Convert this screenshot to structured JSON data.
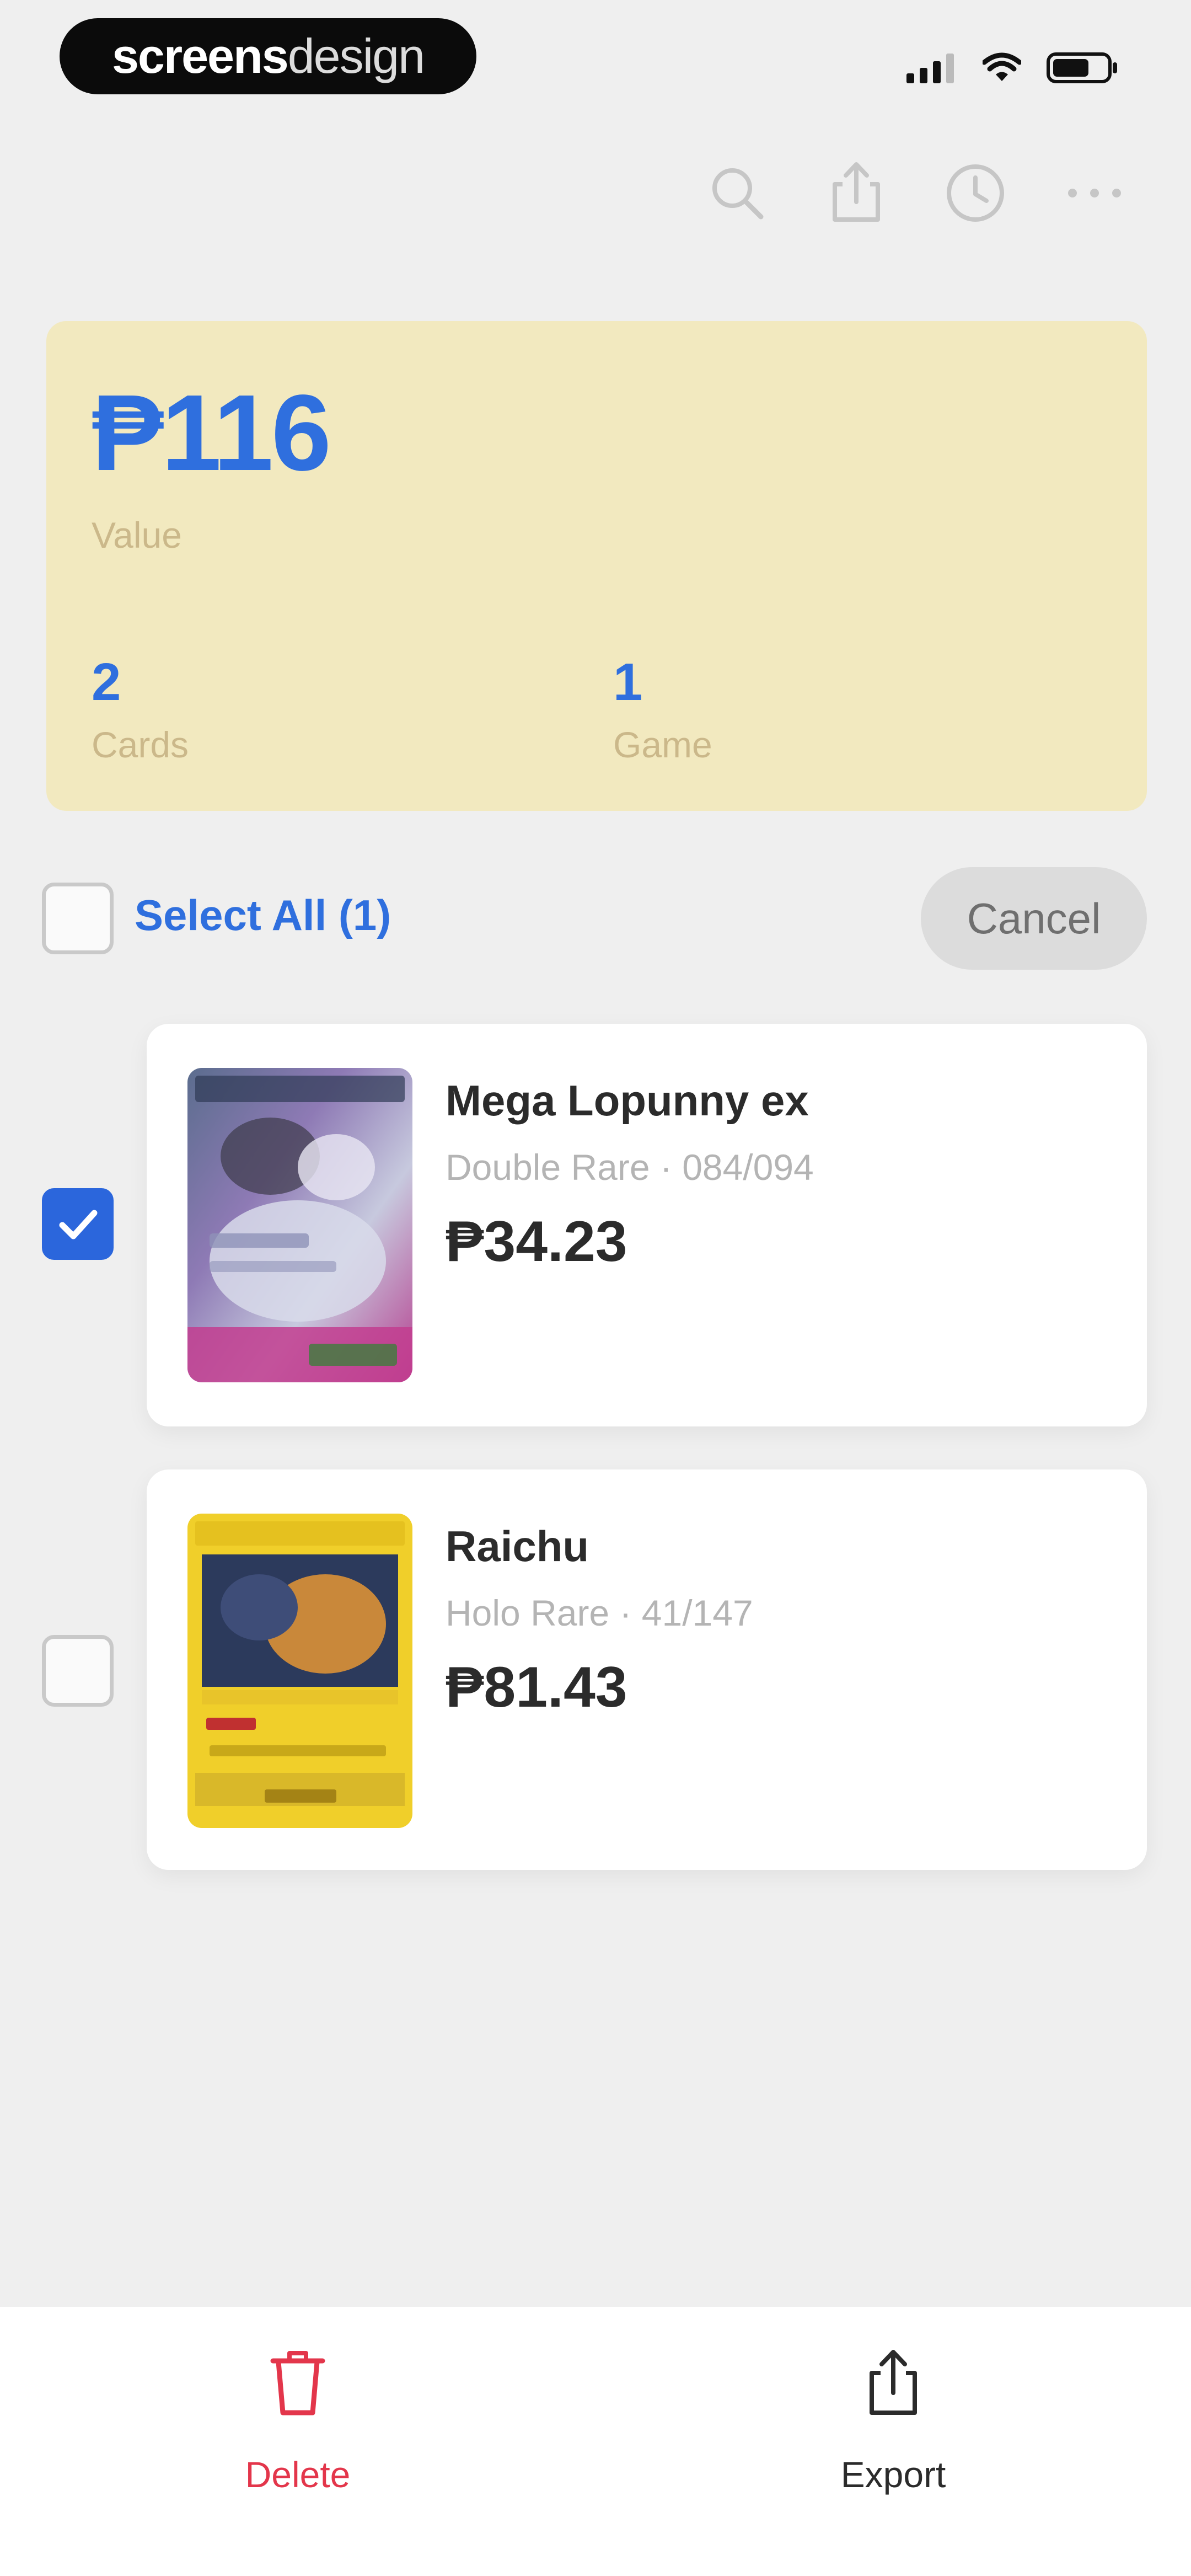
{
  "watermark": {
    "bold": "screens",
    "light": "design"
  },
  "status_bar": {
    "icons": [
      "signal-icon",
      "wifi-icon",
      "battery-icon"
    ]
  },
  "toolbar": {
    "icons": [
      "search-icon",
      "share-icon",
      "history-icon",
      "more-icon"
    ]
  },
  "summary": {
    "value": "₱116",
    "value_label": "Value",
    "cards_count": "2",
    "cards_label": "Cards",
    "games_count": "1",
    "games_label": "Game"
  },
  "selection": {
    "select_all_label": "Select All (1)",
    "cancel_label": "Cancel"
  },
  "cards": [
    {
      "name": "Mega Lopunny ex",
      "meta": "Double Rare · 084/094",
      "price": "₱34.23",
      "selected": true
    },
    {
      "name": "Raichu",
      "meta": "Holo Rare · 41/147",
      "price": "₱81.43",
      "selected": false
    }
  ],
  "bottom_bar": {
    "delete_label": "Delete",
    "export_label": "Export"
  },
  "colors": {
    "accent": "#2f6fde",
    "summary_bg": "#f2e9bf",
    "danger": "#e3364b"
  }
}
